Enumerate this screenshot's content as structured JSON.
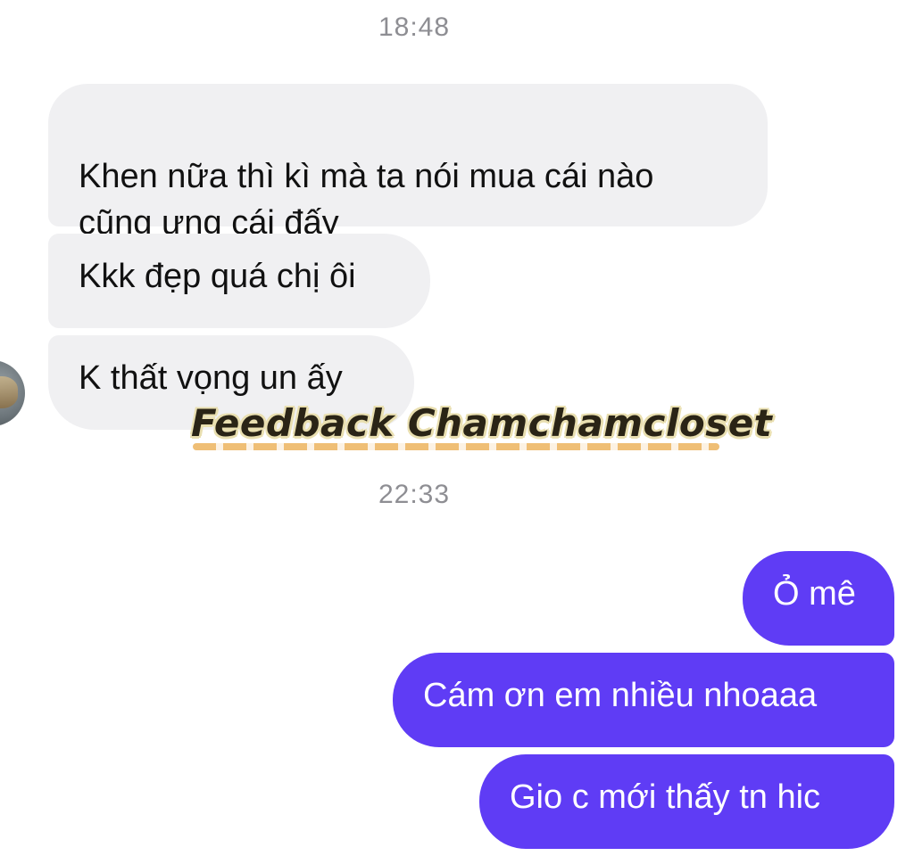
{
  "timestamps": {
    "first": "18:48",
    "second": "22:33"
  },
  "incoming_messages": [
    "Khen nữa thì kì mà ta nói mua cái nào\ncũng ưng cái đấy",
    "Kkk đẹp quá chị ôi",
    "K thất vọng un ấy"
  ],
  "outgoing_messages": [
    "Ỏ mê",
    "Cám ơn em nhiều nhoaaa",
    "Gio c mới thấy tn hic"
  ],
  "watermark": {
    "text": "Feedback Chamchamcloset"
  },
  "colors": {
    "incoming_bubble": "#f0f0f2",
    "outgoing_bubble": "#5f3cf5",
    "timestamp": "#8e8e93"
  }
}
